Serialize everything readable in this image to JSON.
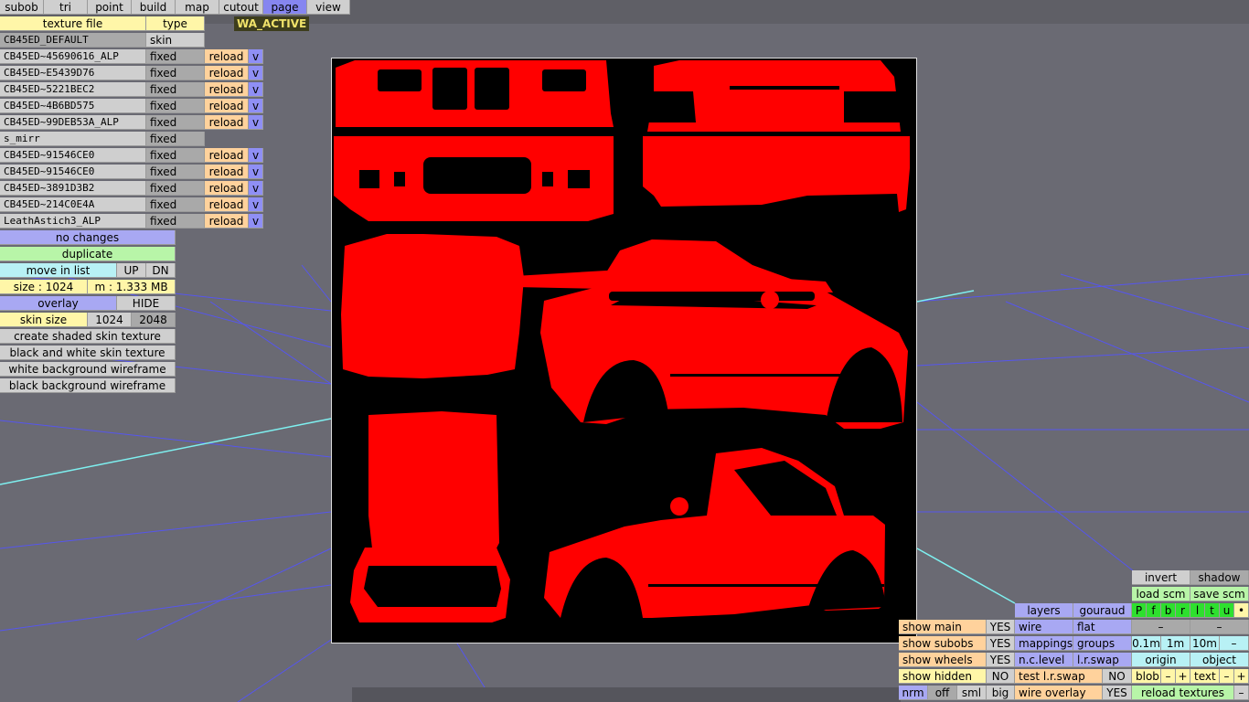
{
  "menu": [
    "subob",
    "tri",
    "point",
    "build",
    "map",
    "cutout",
    "page",
    "view"
  ],
  "active_menu": "page",
  "badge": "WA_ACTIVE",
  "texture_header": {
    "file": "texture file",
    "type": "type"
  },
  "textures": [
    {
      "name": "CB45ED_DEFAULT",
      "type": "skin",
      "reload": "",
      "v": ""
    },
    {
      "name": "CB45ED~45690616_ALP",
      "type": "fixed",
      "reload": "reload",
      "v": "v"
    },
    {
      "name": "CB45ED~E5439D76",
      "type": "fixed",
      "reload": "reload",
      "v": "v"
    },
    {
      "name": "CB45ED~5221BEC2",
      "type": "fixed",
      "reload": "reload",
      "v": "v"
    },
    {
      "name": "CB45ED~4B6BD575",
      "type": "fixed",
      "reload": "reload",
      "v": "v"
    },
    {
      "name": "CB45ED~99DEB53A_ALP",
      "type": "fixed",
      "reload": "reload",
      "v": "v"
    },
    {
      "name": "s_mirr",
      "type": "fixed",
      "reload": "",
      "v": ""
    },
    {
      "name": "CB45ED~91546CE0",
      "type": "fixed",
      "reload": "reload",
      "v": "v"
    },
    {
      "name": "CB45ED~91546CE0",
      "type": "fixed",
      "reload": "reload",
      "v": "v"
    },
    {
      "name": "CB45ED~3891D3B2",
      "type": "fixed",
      "reload": "reload",
      "v": "v"
    },
    {
      "name": "CB45ED~214C0E4A",
      "type": "fixed",
      "reload": "reload",
      "v": "v"
    },
    {
      "name": "LeathAstich3_ALP",
      "type": "fixed",
      "reload": "reload",
      "v": "v"
    }
  ],
  "left_panel": {
    "no_changes": "no changes",
    "duplicate": "duplicate",
    "move_in_list": "move in list",
    "up": "UP",
    "dn": "DN",
    "size": "size : 1024",
    "mem": "m : 1.333 MB",
    "overlay": "overlay",
    "hide": "HIDE",
    "skin_size": "skin size",
    "s1024": "1024",
    "s2048": "2048",
    "create_shaded": "create shaded skin texture",
    "bw_skin": "black and white skin texture",
    "white_bg": "white background wireframe",
    "black_bg": "black background wireframe"
  },
  "right_panel": {
    "invert": "invert",
    "shadow": "shadow",
    "load_scm": "load scm",
    "save_scm": "save scm",
    "layers": "layers",
    "gouraud": "gouraud",
    "flags": [
      "P",
      "f",
      "b",
      "r",
      "l",
      "t",
      "u",
      "•"
    ],
    "wire": "wire",
    "flat": "flat",
    "dash": "–",
    "mappings": "mappings",
    "groups": "groups",
    "d01": "0.1m",
    "d1": "1m",
    "d10": "10m",
    "nclevel": "n.c.level",
    "lrswap": "l.r.swap",
    "origin": "origin",
    "object": "object",
    "test_lrswap": "test l.r.swap",
    "no": "NO",
    "yes": "YES",
    "blob": "blob",
    "minus": "–",
    "plus": "+",
    "text": "text",
    "show_main": "show main",
    "show_subobs": "show subobs",
    "show_wheels": "show wheels",
    "show_hidden": "show hidden",
    "nrm": "nrm",
    "off": "off",
    "sml": "sml",
    "big": "big",
    "wire_overlay": "wire overlay",
    "reload_textures": "reload textures"
  },
  "colors": {
    "texture_fill": "#ff0000",
    "viewport": "#6a6a73",
    "grid": "#5a5aff"
  }
}
